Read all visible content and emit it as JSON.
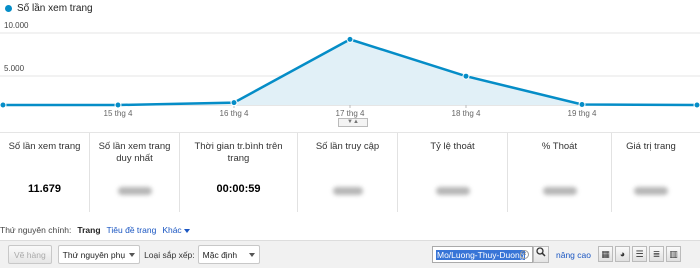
{
  "chart_data": {
    "type": "area",
    "legend": "Số lần xem trang",
    "y_ticks": [
      "10.000",
      "5.000"
    ],
    "ylim": [
      0,
      10000
    ],
    "x_labels": [
      "15 thg 4",
      "16 thg 4",
      "17 thg 4",
      "18 thg 4",
      "19 thg 4"
    ],
    "values": [
      0,
      0,
      300,
      8200,
      3600,
      60,
      0
    ],
    "color": "#058dc7",
    "fill": "#e1f0f7"
  },
  "scorecards": [
    {
      "label": "Số lần xem trang",
      "value": "11.679"
    },
    {
      "label": "Số lần xem trang duy nhất",
      "value": ""
    },
    {
      "label": "Thời gian tr.bình trên trang",
      "value": "00:00:59"
    },
    {
      "label": "Số lần truy cập",
      "value": ""
    },
    {
      "label": "Tỷ lệ thoát",
      "value": ""
    },
    {
      "label": "% Thoát",
      "value": ""
    },
    {
      "label": "Giá trị trang",
      "value": ""
    }
  ],
  "dimension": {
    "primary_label": "Thứ nguyên chính:",
    "active": "Trang",
    "title_link": "Tiêu đề trang",
    "other": "Khác"
  },
  "toolbar": {
    "plot_button": "Vẽ hàng",
    "secondary_dimension": "Thứ nguyên phụ",
    "sort_label": "Loại sắp xếp:",
    "sort_value": "Mặc định",
    "search_value": "Mo/Luong-Thuy-Duong",
    "advanced": "nâng cao"
  }
}
